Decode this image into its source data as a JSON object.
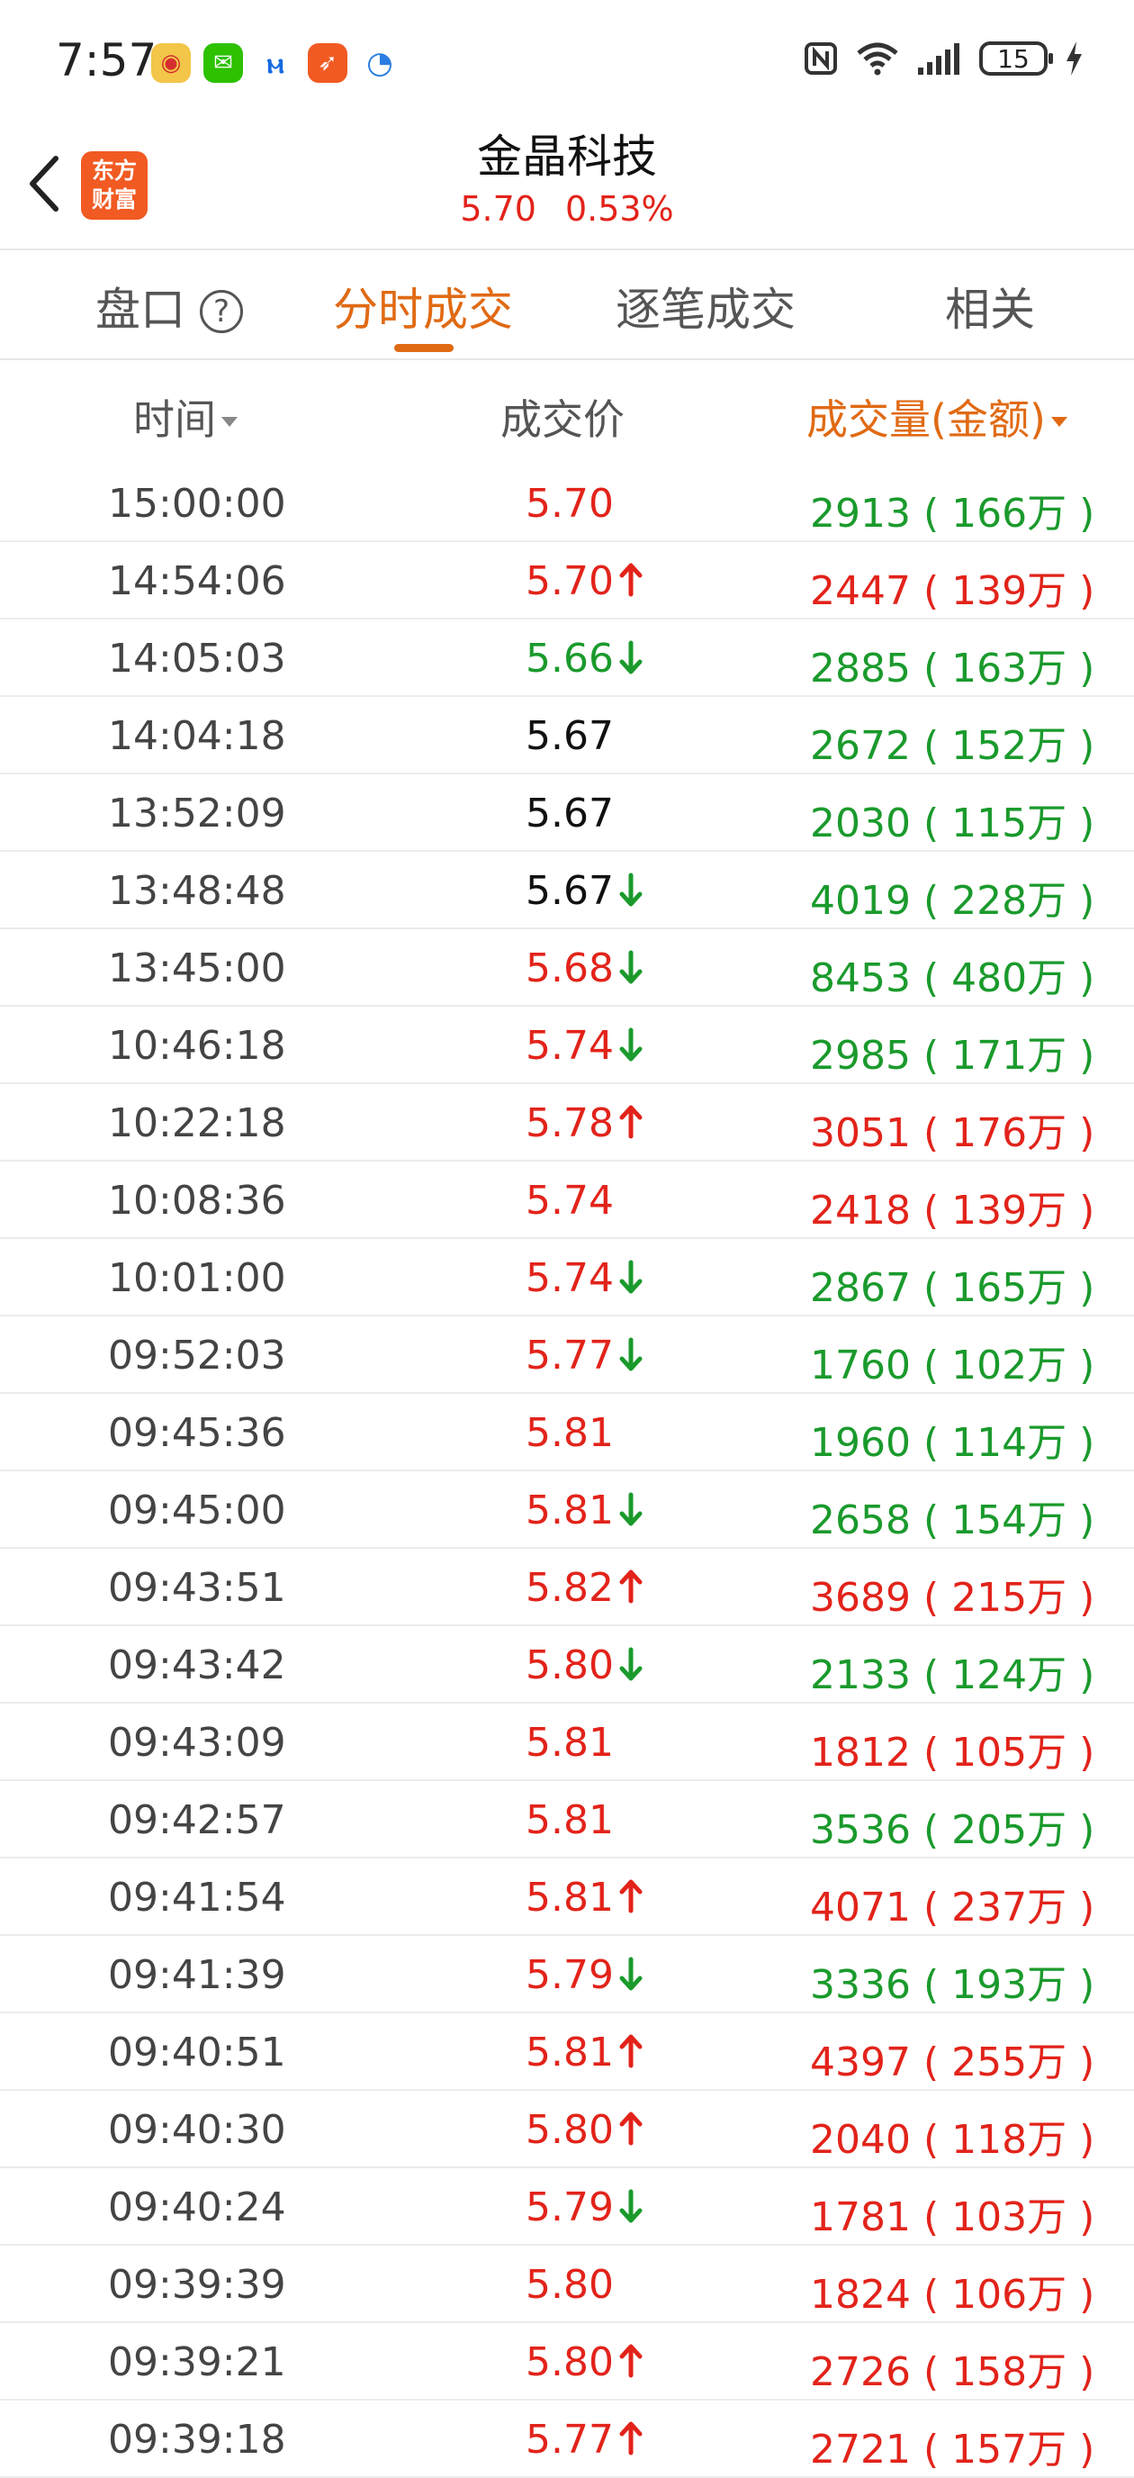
{
  "status_bar": {
    "time": "7:57",
    "battery": "15",
    "apps": [
      "weibo-icon",
      "wechat-icon",
      "app-m-icon",
      "app-orange-icon",
      "app-blue-icon"
    ]
  },
  "header": {
    "logo_line1": "东方",
    "logo_line2": "财富",
    "stock_name": "金晶科技",
    "price": "5.70",
    "change_pct": "0.53%"
  },
  "tabs": [
    {
      "label": "盘口",
      "active": false
    },
    {
      "label": "分时成交",
      "active": true
    },
    {
      "label": "逐笔成交",
      "active": false
    },
    {
      "label": "相关",
      "active": false
    }
  ],
  "columns": {
    "time": "时间",
    "price": "成交价",
    "volume": "成交量(金额)"
  },
  "colors": {
    "up": "#e2231a",
    "down": "#1a9a2c",
    "flat": "#111111",
    "accent": "#e06a14"
  },
  "trades": [
    {
      "time": "15:00:00",
      "price": "5.70",
      "price_color": "red",
      "arrow": "",
      "volume": "2913 ( 166万 )",
      "volume_color": "green"
    },
    {
      "time": "14:54:06",
      "price": "5.70",
      "price_color": "red",
      "arrow": "up",
      "volume": "2447 ( 139万 )",
      "volume_color": "red"
    },
    {
      "time": "14:05:03",
      "price": "5.66",
      "price_color": "green",
      "arrow": "down",
      "volume": "2885 ( 163万 )",
      "volume_color": "green"
    },
    {
      "time": "14:04:18",
      "price": "5.67",
      "price_color": "black",
      "arrow": "",
      "volume": "2672 ( 152万 )",
      "volume_color": "green"
    },
    {
      "time": "13:52:09",
      "price": "5.67",
      "price_color": "black",
      "arrow": "",
      "volume": "2030 ( 115万 )",
      "volume_color": "green"
    },
    {
      "time": "13:48:48",
      "price": "5.67",
      "price_color": "black",
      "arrow": "down",
      "volume": "4019 ( 228万 )",
      "volume_color": "green"
    },
    {
      "time": "13:45:00",
      "price": "5.68",
      "price_color": "red",
      "arrow": "down",
      "volume": "8453 ( 480万 )",
      "volume_color": "green"
    },
    {
      "time": "10:46:18",
      "price": "5.74",
      "price_color": "red",
      "arrow": "down",
      "volume": "2985 ( 171万 )",
      "volume_color": "green"
    },
    {
      "time": "10:22:18",
      "price": "5.78",
      "price_color": "red",
      "arrow": "up",
      "volume": "3051 ( 176万 )",
      "volume_color": "red"
    },
    {
      "time": "10:08:36",
      "price": "5.74",
      "price_color": "red",
      "arrow": "",
      "volume": "2418 ( 139万 )",
      "volume_color": "red"
    },
    {
      "time": "10:01:00",
      "price": "5.74",
      "price_color": "red",
      "arrow": "down",
      "volume": "2867 ( 165万 )",
      "volume_color": "green"
    },
    {
      "time": "09:52:03",
      "price": "5.77",
      "price_color": "red",
      "arrow": "down",
      "volume": "1760 ( 102万 )",
      "volume_color": "green"
    },
    {
      "time": "09:45:36",
      "price": "5.81",
      "price_color": "red",
      "arrow": "",
      "volume": "1960 ( 114万 )",
      "volume_color": "green"
    },
    {
      "time": "09:45:00",
      "price": "5.81",
      "price_color": "red",
      "arrow": "down",
      "volume": "2658 ( 154万 )",
      "volume_color": "green"
    },
    {
      "time": "09:43:51",
      "price": "5.82",
      "price_color": "red",
      "arrow": "up",
      "volume": "3689 ( 215万 )",
      "volume_color": "red"
    },
    {
      "time": "09:43:42",
      "price": "5.80",
      "price_color": "red",
      "arrow": "down",
      "volume": "2133 ( 124万 )",
      "volume_color": "green"
    },
    {
      "time": "09:43:09",
      "price": "5.81",
      "price_color": "red",
      "arrow": "",
      "volume": "1812 ( 105万 )",
      "volume_color": "red"
    },
    {
      "time": "09:42:57",
      "price": "5.81",
      "price_color": "red",
      "arrow": "",
      "volume": "3536 ( 205万 )",
      "volume_color": "green"
    },
    {
      "time": "09:41:54",
      "price": "5.81",
      "price_color": "red",
      "arrow": "up",
      "volume": "4071 ( 237万 )",
      "volume_color": "red"
    },
    {
      "time": "09:41:39",
      "price": "5.79",
      "price_color": "red",
      "arrow": "down",
      "volume": "3336 ( 193万 )",
      "volume_color": "green"
    },
    {
      "time": "09:40:51",
      "price": "5.81",
      "price_color": "red",
      "arrow": "up",
      "volume": "4397 ( 255万 )",
      "volume_color": "red"
    },
    {
      "time": "09:40:30",
      "price": "5.80",
      "price_color": "red",
      "arrow": "up",
      "volume": "2040 ( 118万 )",
      "volume_color": "red"
    },
    {
      "time": "09:40:24",
      "price": "5.79",
      "price_color": "red",
      "arrow": "down",
      "volume": "1781 ( 103万 )",
      "volume_color": "red"
    },
    {
      "time": "09:39:39",
      "price": "5.80",
      "price_color": "red",
      "arrow": "",
      "volume": "1824 ( 106万 )",
      "volume_color": "red"
    },
    {
      "time": "09:39:21",
      "price": "5.80",
      "price_color": "red",
      "arrow": "up",
      "volume": "2726 ( 158万 )",
      "volume_color": "red"
    },
    {
      "time": "09:39:18",
      "price": "5.77",
      "price_color": "red",
      "arrow": "up",
      "volume": "2721 ( 157万 )",
      "volume_color": "red"
    }
  ]
}
